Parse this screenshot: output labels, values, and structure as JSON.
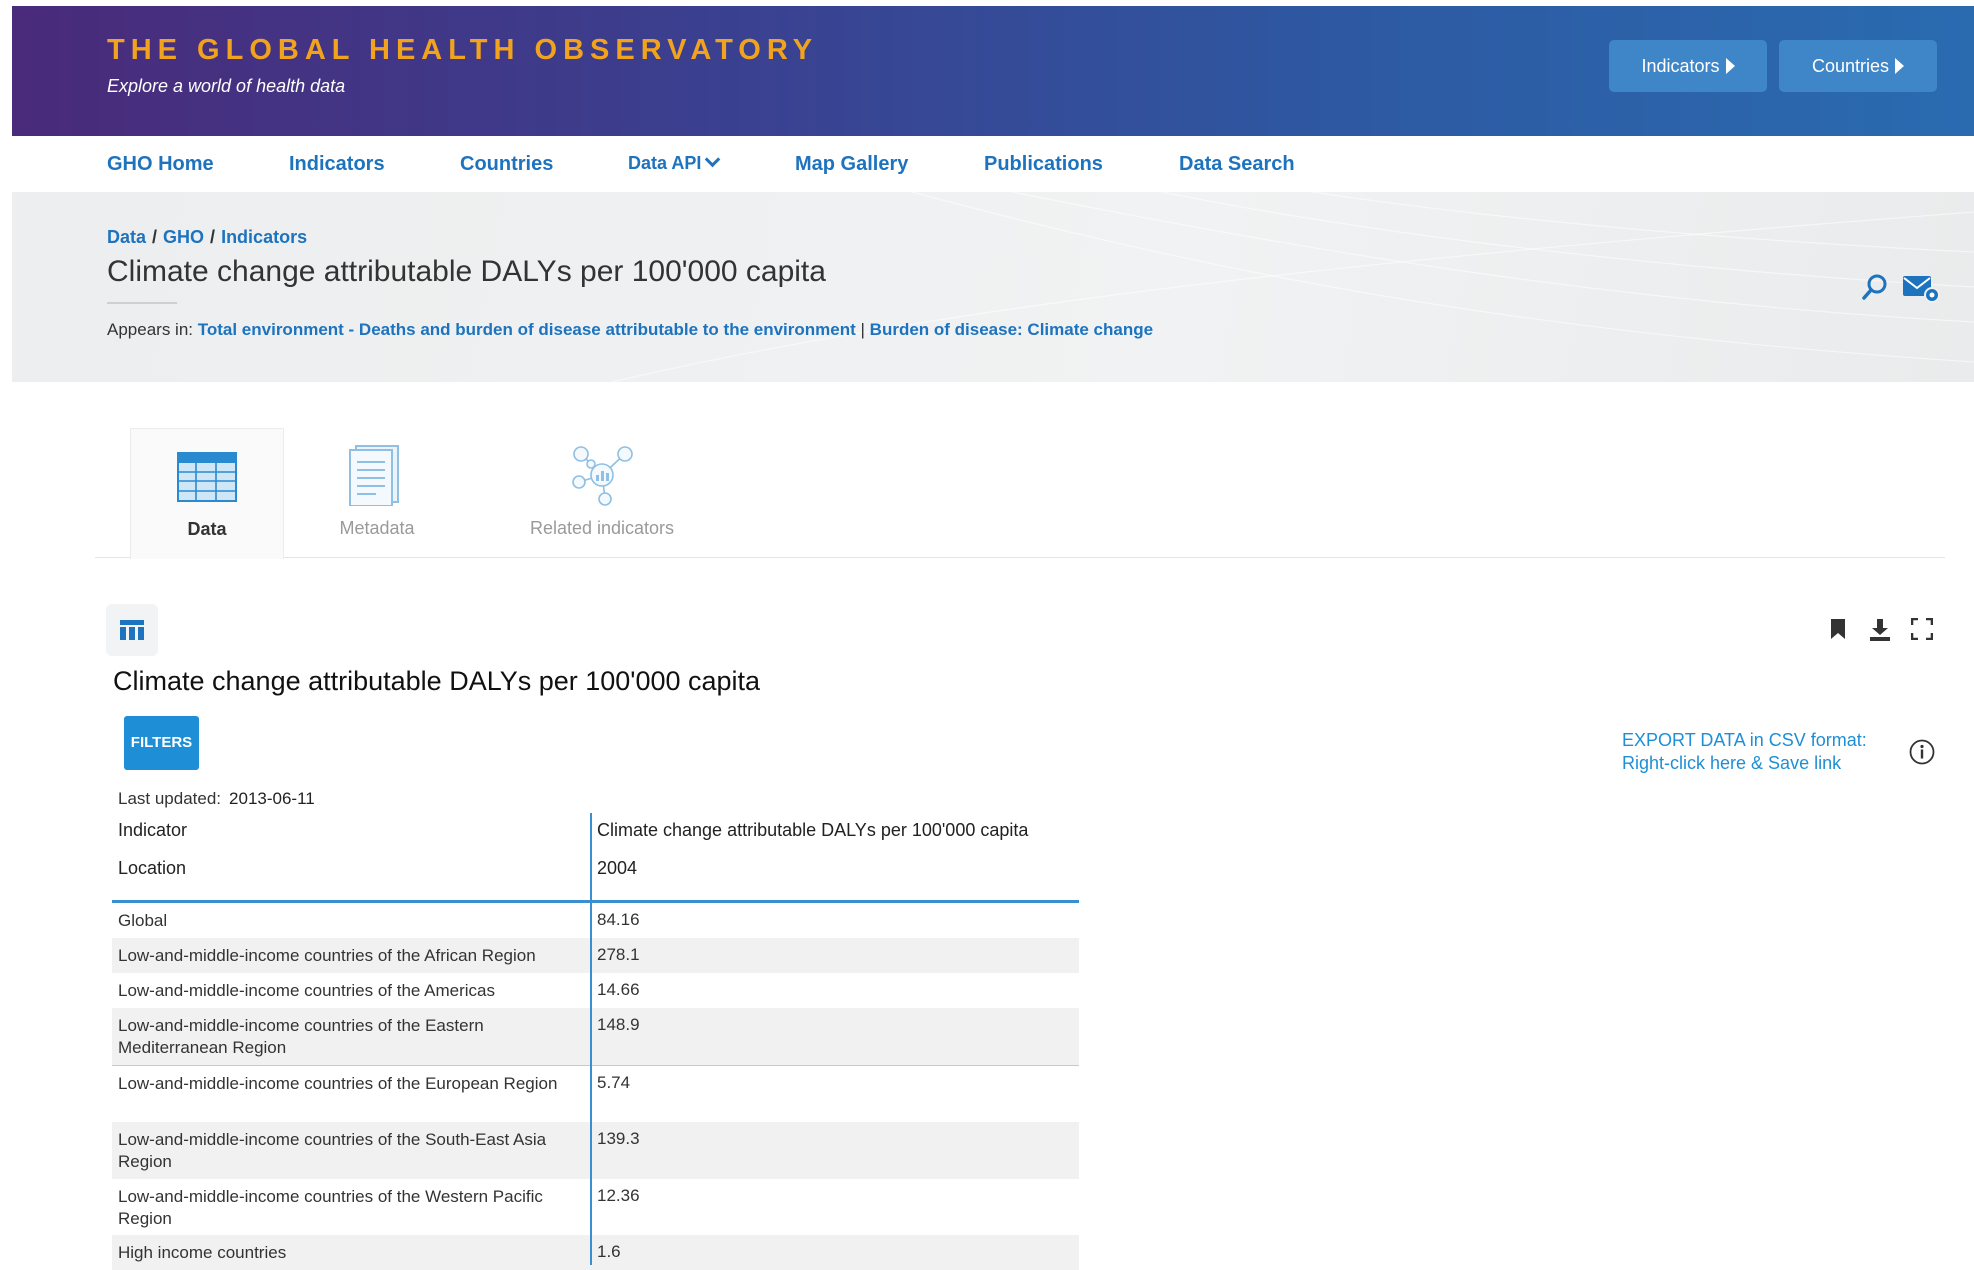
{
  "header": {
    "site_title": "THE GLOBAL HEALTH OBSERVATORY",
    "tagline": "Explore a world of health data",
    "buttons": {
      "indicators": "Indicators",
      "countries": "Countries"
    }
  },
  "nav": {
    "items": [
      "GHO Home",
      "Indicators",
      "Countries",
      "Data API",
      "Map Gallery",
      "Publications",
      "Data Search"
    ]
  },
  "breadcrumb": [
    "Data",
    "GHO",
    "Indicators"
  ],
  "page": {
    "title": "Climate change attributable DALYs per 100'000 capita",
    "appears_label": "Appears in:",
    "appears_link1": "Total environment - Deaths and burden of disease attributable to the environment",
    "appears_sep": "|",
    "appears_link2": "Burden of disease: Climate change"
  },
  "tabs": [
    "Data",
    "Metadata",
    "Related indicators"
  ],
  "viz": {
    "title": "Climate change attributable DALYs per 100'000 capita",
    "filters_label": "FILTERS",
    "last_updated_label": "Last updated:",
    "last_updated_value": "2013-06-11",
    "export_line1": "EXPORT DATA in CSV format:",
    "export_line2": "Right-click here & Save link"
  },
  "table": {
    "header_row1": {
      "label": "Indicator",
      "value": "Climate change attributable DALYs per 100'000 capita"
    },
    "header_row2": {
      "label": "Location",
      "value": "2004"
    },
    "rows": [
      {
        "location": "Global",
        "value": "84.16"
      },
      {
        "location": "Low-and-middle-income countries of the African Region",
        "value": "278.1"
      },
      {
        "location": "Low-and-middle-income countries of the Americas",
        "value": "14.66"
      },
      {
        "location": "Low-and-middle-income countries of the Eastern Mediterranean Region",
        "value": "148.9"
      },
      {
        "location": "Low-and-middle-income countries of the European Region",
        "value": "5.74"
      },
      {
        "location": "Low-and-middle-income countries of the South-East Asia Region",
        "value": "139.3"
      },
      {
        "location": "Low-and-middle-income countries of the Western Pacific Region",
        "value": "12.36"
      },
      {
        "location": "High income countries",
        "value": "1.6"
      }
    ]
  },
  "colors": {
    "brand_orange": "#f2a31d",
    "link_blue": "#1e73be",
    "accent_blue": "#1e8fd6"
  },
  "icons": [
    "search-icon",
    "email-icon",
    "table-icon",
    "bookmark-icon",
    "download-icon",
    "fullscreen-icon",
    "info-icon"
  ]
}
